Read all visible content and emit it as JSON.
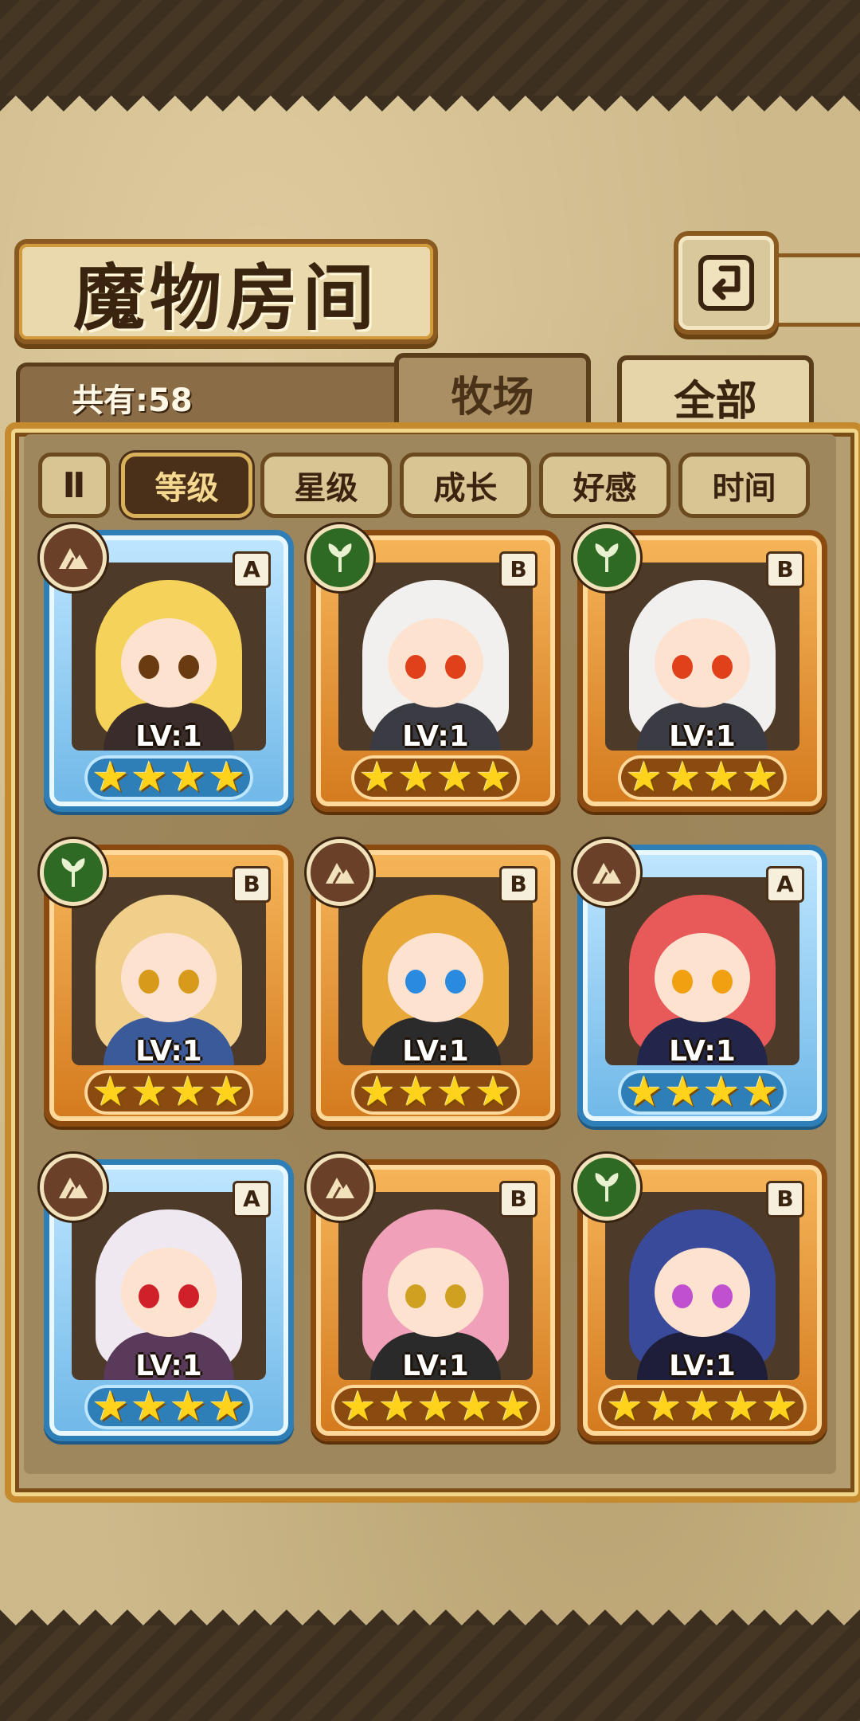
{
  "header": {
    "title": "魔物房间",
    "back_icon": "return-icon"
  },
  "summary": {
    "count_label": "共有:58"
  },
  "tabs": [
    {
      "label": "牧场",
      "active": false
    },
    {
      "label": "全部",
      "active": true
    }
  ],
  "sort": {
    "toggle_glyph": "Ⅱ",
    "options": [
      {
        "label": "等级",
        "active": true
      },
      {
        "label": "星级",
        "active": false
      },
      {
        "label": "成长",
        "active": false
      },
      {
        "label": "好感",
        "active": false
      },
      {
        "label": "时间",
        "active": false
      }
    ]
  },
  "monsters": [
    {
      "rank": "A",
      "element": "earth-icon",
      "level": "LV:1",
      "stars": 4
    },
    {
      "rank": "B",
      "element": "leaf-icon",
      "level": "LV:1",
      "stars": 4
    },
    {
      "rank": "B",
      "element": "leaf-icon",
      "level": "LV:1",
      "stars": 4
    },
    {
      "rank": "B",
      "element": "leaf-icon",
      "level": "LV:1",
      "stars": 4
    },
    {
      "rank": "B",
      "element": "earth-icon",
      "level": "LV:1",
      "stars": 4
    },
    {
      "rank": "A",
      "element": "earth-icon",
      "level": "LV:1",
      "stars": 4
    },
    {
      "rank": "A",
      "element": "earth-icon",
      "level": "LV:1",
      "stars": 4
    },
    {
      "rank": "B",
      "element": "earth-icon",
      "level": "LV:1",
      "stars": 5
    },
    {
      "rank": "B",
      "element": "leaf-icon",
      "level": "LV:1",
      "stars": 5
    }
  ],
  "colors": {
    "rank_a_frame": "#2e7fb8",
    "rank_b_frame": "#d47a1e",
    "star": "#ffd21c"
  }
}
